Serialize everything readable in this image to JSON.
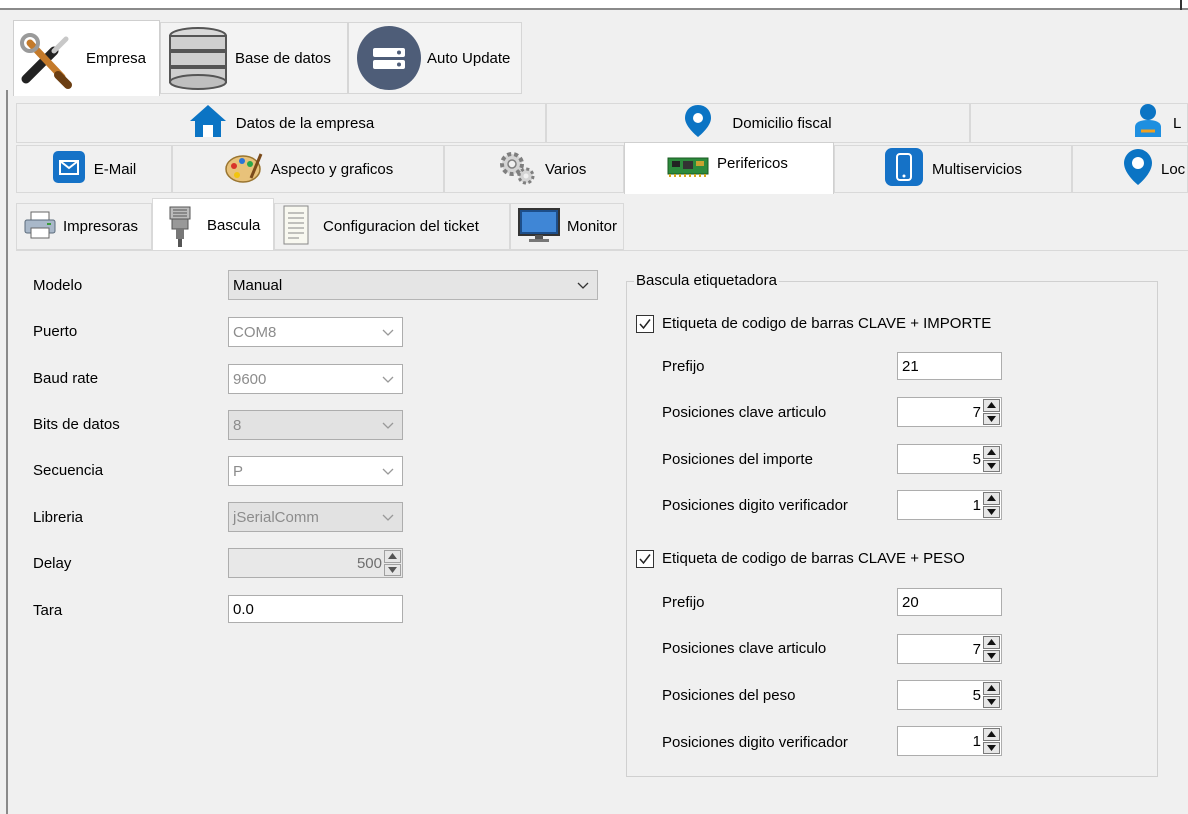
{
  "main_tabs": [
    {
      "label": "Empresa",
      "icon": "tools-icon"
    },
    {
      "label": "Base de datos",
      "icon": "database-icon"
    },
    {
      "label": "Auto Update",
      "icon": "server-icon"
    }
  ],
  "section_tabs_row1": [
    {
      "label": "Datos de la empresa",
      "icon": "home-icon"
    },
    {
      "label": "Domicilio fiscal",
      "icon": "map-pin-icon"
    },
    {
      "label": "L",
      "icon": "user-map-icon"
    }
  ],
  "section_tabs_row2": [
    {
      "label": "E-Mail",
      "icon": "mail-icon"
    },
    {
      "label": "Aspecto y graficos",
      "icon": "palette-icon"
    },
    {
      "label": "Varios",
      "icon": "gears-icon"
    },
    {
      "label": "Perifericos",
      "icon": "circuit-board-icon"
    },
    {
      "label": "Multiservicios",
      "icon": "phone-icon"
    },
    {
      "label": "Loc",
      "icon": "map-pin-icon"
    }
  ],
  "sub_tabs": [
    {
      "label": "Impresoras",
      "icon": "printer-icon"
    },
    {
      "label": "Bascula",
      "icon": "serial-connector-icon"
    },
    {
      "label": "Configuracion del ticket",
      "icon": "receipt-icon"
    },
    {
      "label": "Monitor",
      "icon": "monitor-icon"
    }
  ],
  "form": {
    "modelo": {
      "label": "Modelo",
      "value": "Manual"
    },
    "puerto": {
      "label": "Puerto",
      "value": "COM8"
    },
    "baud_rate": {
      "label": "Baud rate",
      "value": "9600"
    },
    "bits_datos": {
      "label": "Bits de datos",
      "value": "8"
    },
    "secuencia": {
      "label": "Secuencia",
      "value": "P"
    },
    "libreria": {
      "label": "Libreria",
      "value": "jSerialComm"
    },
    "delay": {
      "label": "Delay",
      "value": "500"
    },
    "tara": {
      "label": "Tara",
      "value": "0.0"
    }
  },
  "bascula_etiquetadora": {
    "title": "Bascula etiquetadora",
    "importe": {
      "checkbox_label": "Etiqueta de codigo de barras CLAVE + IMPORTE",
      "checked": true,
      "prefijo_label": "Prefijo",
      "prefijo": "21",
      "clave_label": "Posiciones clave articulo",
      "clave": "7",
      "importe_label": "Posiciones del importe",
      "importe": "5",
      "verificador_label": "Posiciones digito verificador",
      "verificador": "1"
    },
    "peso": {
      "checkbox_label": "Etiqueta de codigo de barras CLAVE + PESO",
      "checked": true,
      "prefijo_label": "Prefijo",
      "prefijo": "20",
      "clave_label": "Posiciones clave articulo",
      "clave": "7",
      "peso_label": "Posiciones del peso",
      "peso": "5",
      "verificador_label": "Posiciones digito verificador",
      "verificador": "1"
    }
  }
}
